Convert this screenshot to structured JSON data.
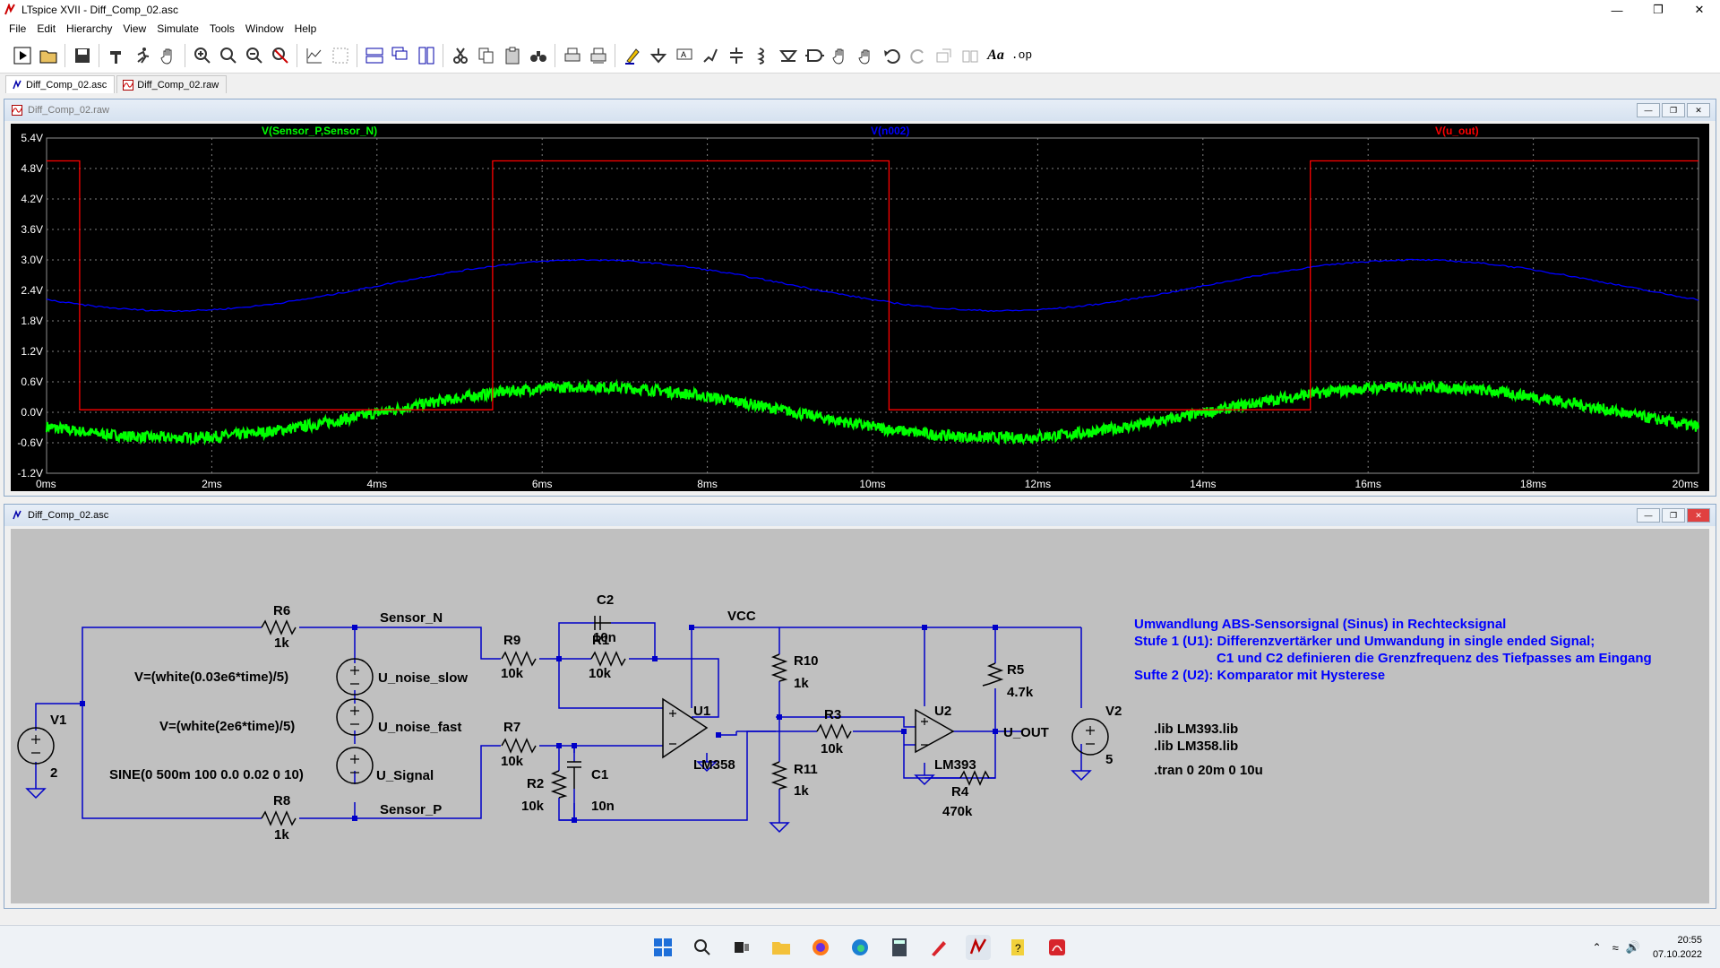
{
  "window": {
    "title": "LTspice XVII - Diff_Comp_02.asc"
  },
  "menu": [
    "File",
    "Edit",
    "Hierarchy",
    "View",
    "Simulate",
    "Tools",
    "Window",
    "Help"
  ],
  "tabs": [
    {
      "label": "Diff_Comp_02.asc"
    },
    {
      "label": "Diff_Comp_02.raw"
    }
  ],
  "toolbar": {
    "op_label": ".op",
    "text_label": "Aa"
  },
  "waveform_window": {
    "title": "Diff_Comp_02.raw"
  },
  "schematic_window": {
    "title": "Diff_Comp_02.asc"
  },
  "chart_data": {
    "type": "line",
    "x_unit": "ms",
    "xlim": [
      0,
      20
    ],
    "ylim": [
      -1.2,
      5.4
    ],
    "x_ticks": [
      "0ms",
      "2ms",
      "4ms",
      "6ms",
      "8ms",
      "10ms",
      "12ms",
      "14ms",
      "16ms",
      "18ms",
      "20ms"
    ],
    "y_ticks": [
      "5.4V",
      "4.8V",
      "4.2V",
      "3.6V",
      "3.0V",
      "2.4V",
      "1.8V",
      "1.2V",
      "0.6V",
      "0.0V",
      "-0.6V",
      "-1.2V"
    ],
    "grid": true,
    "background": "#000000",
    "series": [
      {
        "name": "V(Sensor_P,Sensor_N)",
        "color": "#00ff00",
        "amplitude": 0.5,
        "offset": 0.0,
        "freq_hz": 100,
        "noise": true
      },
      {
        "name": "V(n002)",
        "color": "#0000ff",
        "amplitude": 0.5,
        "offset": 2.5,
        "freq_hz": 100,
        "noise": false
      },
      {
        "name": "V(u_out)",
        "color": "#ff0000",
        "x": [
          0,
          0.4,
          0.4,
          5.4,
          5.4,
          10.2,
          10.2,
          15.3,
          15.3,
          20
        ],
        "y": [
          4.95,
          4.95,
          0.05,
          0.05,
          4.95,
          4.95,
          0.05,
          0.05,
          4.95,
          4.95
        ]
      }
    ]
  },
  "schematic": {
    "labels": {
      "r6": "R6",
      "r6v": "1k",
      "r8": "R8",
      "r8v": "1k",
      "sensor_n": "Sensor_N",
      "sensor_p": "Sensor_P",
      "v1": "V1",
      "v1v": "2",
      "v2": "V2",
      "v2v": "5",
      "src_slow": "V=(white(0.03e6*time)/5)",
      "src_fast": "V=(white(2e6*time)/5)",
      "src_sine": "SINE(0 500m 100 0.0 0.02 0 10)",
      "u_slow": "U_noise_slow",
      "u_fast": "U_noise_fast",
      "u_sig": "U_Signal",
      "r9": "R9",
      "r9v": "10k",
      "r7": "R7",
      "r7v": "10k",
      "r1": "R1",
      "r1v": "10k",
      "c2": "C2",
      "c2v": "10n",
      "r2": "R2",
      "r2v": "10k",
      "c1": "C1",
      "c1v": "10n",
      "u1": "U1",
      "u1m": "LM358",
      "vcc": "VCC",
      "r10": "R10",
      "r10v": "1k",
      "r11": "R11",
      "r11v": "1k",
      "r3": "R3",
      "r3v": "10k",
      "u2": "U2",
      "u2m": "LM393",
      "r5": "R5",
      "r5v": "4.7k",
      "r4": "R4",
      "r4v": "470k",
      "u_out": "U_OUT"
    },
    "comment_lines": [
      "Umwandlung ABS-Sensorsignal (Sinus) in Rechtecksignal",
      "Stufe 1 (U1): Differenzvertärker und Umwandung in single ended Signal;",
      "C1 und C2 definieren die Grenzfrequenz des Tiefpasses am Eingang",
      "Sufte 2 (U2): Komparator mit Hysterese"
    ],
    "directives": [
      ".lib LM393.lib",
      ".lib LM358.lib",
      ".tran 0 20m 0 10u"
    ]
  },
  "taskbar": {
    "time": "20:55",
    "date": "07.10.2022"
  },
  "colors": {
    "wire": "#0000c8",
    "grid": "#808080",
    "comment": "#0000ff"
  }
}
